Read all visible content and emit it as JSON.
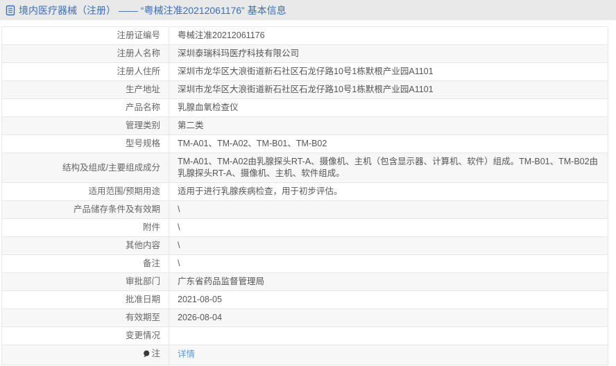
{
  "header": {
    "title": "境内医疗器械（注册） —— “粤械注准20212061176” 基本信息",
    "icon": "document-icon",
    "text_color": "#3a6fb5",
    "background_color": "#e9e9e9"
  },
  "colors": {
    "link_blue": "#5b9bd5",
    "row_alt_gray": "#f7f7f7",
    "table_border": "#c2c2c6",
    "cell_border": "#e8e8e8",
    "label_text": "#666666",
    "value_text": "#555555"
  },
  "table": {
    "rows": [
      {
        "label": "注册证编号",
        "value": "粤械注准20212061176"
      },
      {
        "label": "注册人名称",
        "value": "深圳泰瑞科玛医疗科技有限公司"
      },
      {
        "label": "注册人住所",
        "value": "深圳市龙华区大浪街道新石社区石龙仔路10号1栋默根产业园A1101"
      },
      {
        "label": "生产地址",
        "value": "深圳市龙华区大浪街道新石社区石龙仔路10号1栋默根产业园A1101"
      },
      {
        "label": "产品名称",
        "value": "乳腺血氧检查仪"
      },
      {
        "label": "管理类别",
        "value": "第二类"
      },
      {
        "label": "型号规格",
        "value": "TM-A01、TM-A02、TM-B01、TM-B02"
      },
      {
        "label": "结构及组成/主要组成成分",
        "value": "TM-A01、TM-A02由乳腺探头RT-A、摄像机、主机（包含显示器、计算机、软件）组成。TM-B01、TM-B02由乳腺探头RT-A、摄像机、主机、软件组成。"
      },
      {
        "label": "适用范围/预期用途",
        "value": "适用于进行乳腺疾病检查，用于初步评估。"
      },
      {
        "label": "产品储存条件及有效期",
        "value": "\\"
      },
      {
        "label": "附件",
        "value": "\\"
      },
      {
        "label": "其他内容",
        "value": "\\"
      },
      {
        "label": "备注",
        "value": "\\"
      },
      {
        "label": "审批部门",
        "value": "广东省药品监督管理局"
      },
      {
        "label": "批准日期",
        "value": "2021-08-05"
      },
      {
        "label": "有效期至",
        "value": "2026-08-04"
      },
      {
        "label": "变更情况",
        "value": ""
      },
      {
        "label": "注",
        "value": "详情",
        "value_type": "link",
        "label_icon": "note-balloon-icon"
      }
    ]
  }
}
